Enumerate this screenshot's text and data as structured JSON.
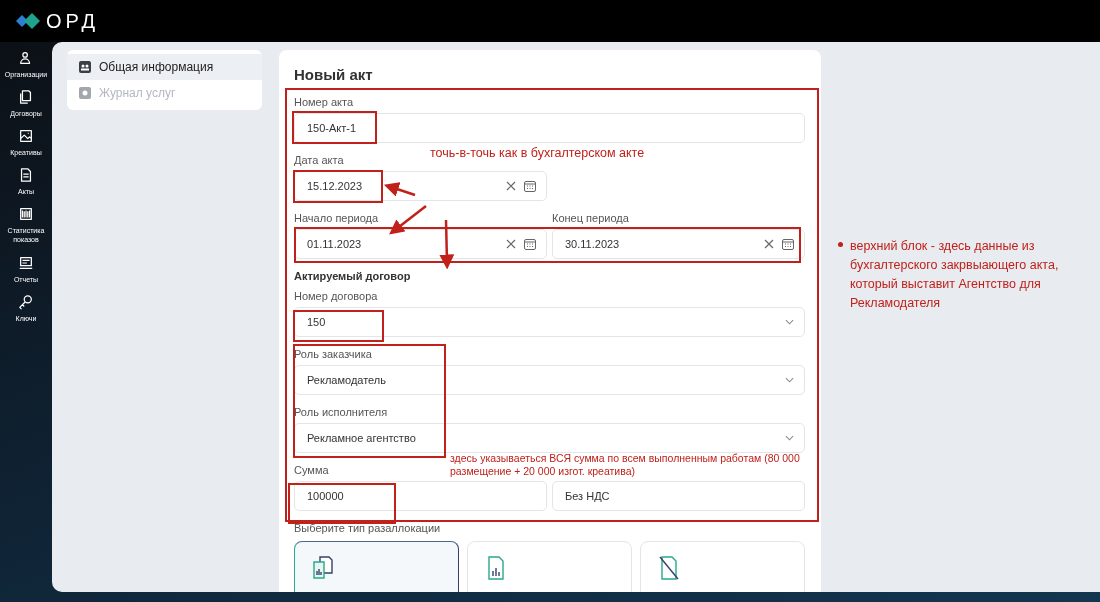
{
  "top_bar": {
    "logo_text": "ОРД"
  },
  "sidebar": {
    "items": [
      {
        "label": "Организации"
      },
      {
        "label": "Договоры"
      },
      {
        "label": "Креативы"
      },
      {
        "label": "Акты"
      },
      {
        "label": "Статистика показов"
      },
      {
        "label": "Отчеты"
      },
      {
        "label": "Ключи"
      }
    ]
  },
  "section_nav": [
    {
      "label": "Общая информация",
      "selected": true,
      "disabled": false
    },
    {
      "label": "Журнал услуг",
      "selected": false,
      "disabled": true
    }
  ],
  "form": {
    "title": "Новый акт",
    "rows": [
      {
        "kind": "fields",
        "fields": [
          {
            "kind": "text",
            "label": "Номер акта",
            "value": "150-Акт-1"
          }
        ]
      },
      {
        "kind": "fields",
        "fields": [
          {
            "kind": "date",
            "label": "Дата акта",
            "value": "15.12.2023"
          }
        ]
      },
      {
        "kind": "fields",
        "fields": [
          {
            "kind": "date",
            "label": "Начало периода",
            "value": "01.11.2023"
          },
          {
            "kind": "date",
            "label": "Конец периода",
            "value": "30.11.2023"
          }
        ]
      },
      {
        "kind": "heading",
        "text": "Актируемый договор"
      },
      {
        "kind": "fields",
        "fields": [
          {
            "kind": "select",
            "label": "Номер договора",
            "value": "150"
          }
        ]
      },
      {
        "kind": "fields",
        "fields": [
          {
            "kind": "select",
            "label": "Роль заказчика",
            "value": "Рекламодатель"
          }
        ]
      },
      {
        "kind": "fields",
        "fields": [
          {
            "kind": "select",
            "label": "Роль исполнителя",
            "value": "Рекламное агентство"
          }
        ]
      },
      {
        "kind": "fields",
        "fields": [
          {
            "kind": "text",
            "label": "Сумма",
            "value": "100000"
          },
          {
            "kind": "text",
            "value": "Без НДС"
          }
        ]
      }
    ],
    "allocation": {
      "label": "Выберите тип разаллокации",
      "options": [
        {
          "selected": true
        },
        {
          "selected": false
        },
        {
          "selected": false
        }
      ]
    }
  },
  "annotations": {
    "exact_note": "точь-в-точь как в бухгалтерском акте",
    "sum_note": "здесь указываеться ВСЯ сумма по всем выполненным работам (80 000 размещение + 20 000 изгот. креатива)",
    "side_note": "верхний блок - здесь данные из бухгалтерского закрвыающего акта, который выставит Агентство для Рекламодателя"
  }
}
